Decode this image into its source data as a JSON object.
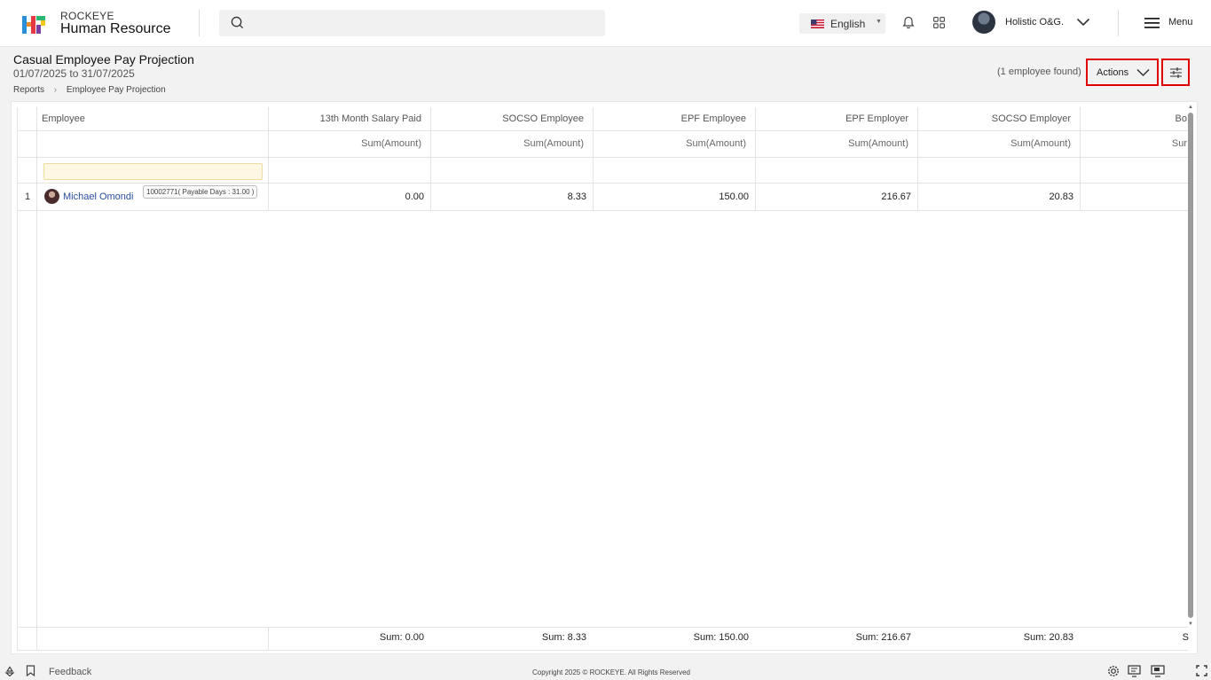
{
  "header": {
    "brand_small": "ROCKEYE",
    "brand_big": "Human Resource",
    "search_placeholder": "",
    "language": "English",
    "user_name": "Holistic O&G.",
    "menu_label": "Menu"
  },
  "page": {
    "title": "Casual Employee Pay Projection",
    "date_range": "01/07/2025 to 31/07/2025",
    "breadcrumb": [
      "Reports",
      "Employee Pay Projection"
    ],
    "found_text": "(1 employee found)",
    "actions_label": "Actions"
  },
  "grid": {
    "employee_header": "Employee",
    "columns": [
      {
        "header": "13th Month Salary Paid",
        "sub": "Sum(Amount)",
        "value": "0.00",
        "sum": "Sum: 0.00"
      },
      {
        "header": "SOCSO Employee",
        "sub": "Sum(Amount)",
        "value": "8.33",
        "sum": "Sum: 8.33"
      },
      {
        "header": "EPF Employee",
        "sub": "Sum(Amount)",
        "value": "150.00",
        "sum": "Sum: 150.00"
      },
      {
        "header": "EPF Employer",
        "sub": "Sum(Amount)",
        "value": "216.67",
        "sum": "Sum: 216.67"
      },
      {
        "header": "SOCSO Employer",
        "sub": "Sum(Amount)",
        "value": "20.83",
        "sum": "Sum: 20.83"
      },
      {
        "header": "Bo",
        "sub": "Sur",
        "value": "",
        "sum": "S"
      }
    ],
    "rows": [
      {
        "index": "1",
        "name": "Michael Omondi",
        "badge": "10002771( Payable Days : 31.00 )"
      }
    ]
  },
  "footer": {
    "feedback": "Feedback",
    "copyright": "Copyright 2025 © ROCKEYE. All Rights Reserved"
  },
  "colors": {
    "accent_red": "#e00000",
    "link_blue": "#2b4f9e"
  }
}
